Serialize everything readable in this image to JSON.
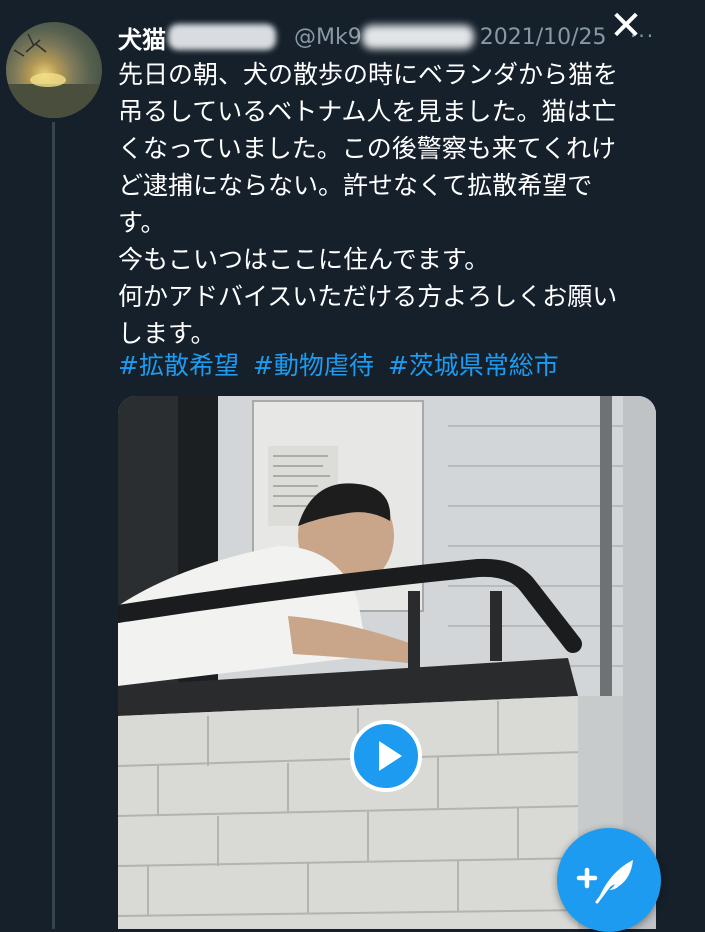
{
  "header": {
    "display_name_visible": "犬猫",
    "handle_visible": "@Mk9",
    "date": "2021/10/25",
    "more": "···"
  },
  "close_label": "✕",
  "tweet": {
    "lines": [
      "先日の朝、犬の散歩の時にベランダから猫を",
      "吊るしているベトナム人を見ました。猫は亡",
      "くなっていました。この後警察も来てくれけ",
      "ど逮捕にならない。許せなくて拡散希望で",
      "す。",
      "今もこいつはここに住んでます。",
      "何かアドバイスいただける方よろしくお願い",
      "します。"
    ],
    "hashtags": [
      "#拡散希望",
      "#動物虐待",
      "#茨城県常総市"
    ]
  },
  "media": {
    "type": "video",
    "play_icon": "play-icon"
  },
  "compose_icon": "compose-tweet-icon",
  "colors": {
    "background": "#15202b",
    "accent": "#1d9bf0",
    "secondary_text": "#8899a6"
  }
}
